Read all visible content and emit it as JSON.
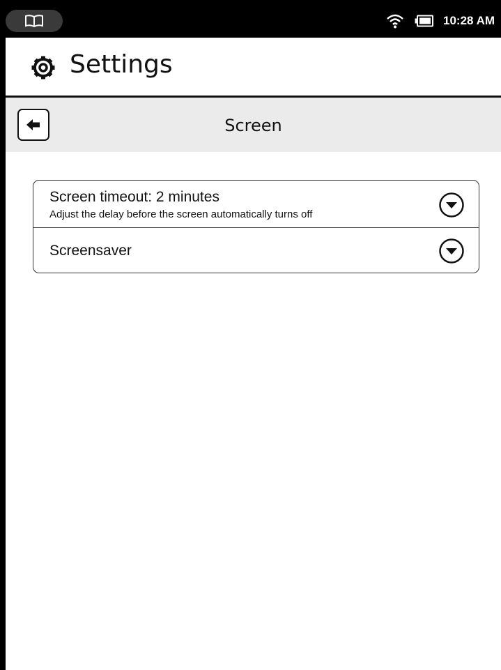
{
  "status_bar": {
    "time": "10:28 AM",
    "icons": [
      "book-icon",
      "wifi-icon",
      "battery-icon"
    ]
  },
  "header": {
    "icon": "gear-icon",
    "title": "Settings"
  },
  "subheader": {
    "back_icon": "arrow-left-icon",
    "title": "Screen"
  },
  "settings": [
    {
      "title": "Screen timeout: 2 minutes",
      "description": "Adjust the delay before the screen automatically turns off",
      "icon": "chevron-down-circle-icon"
    },
    {
      "title": "Screensaver",
      "icon": "chevron-down-circle-icon"
    }
  ]
}
